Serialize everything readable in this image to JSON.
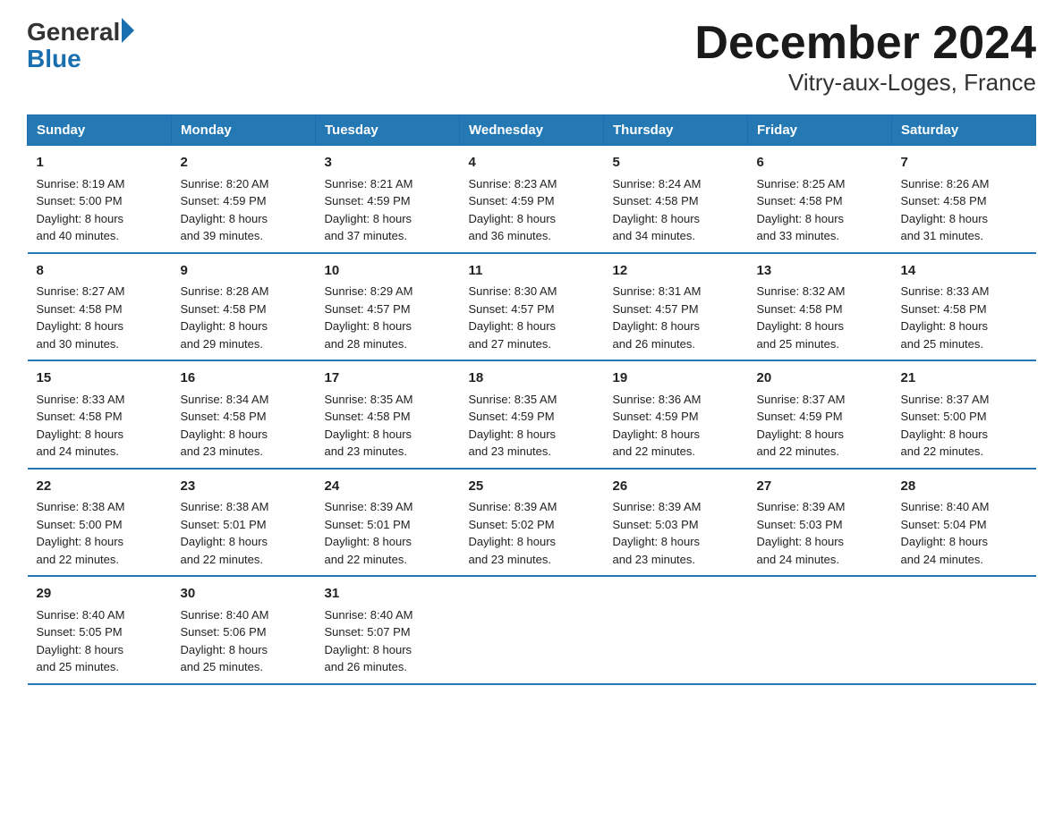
{
  "logo": {
    "general": "General",
    "blue": "Blue"
  },
  "title": "December 2024",
  "subtitle": "Vitry-aux-Loges, France",
  "headers": [
    "Sunday",
    "Monday",
    "Tuesday",
    "Wednesday",
    "Thursday",
    "Friday",
    "Saturday"
  ],
  "weeks": [
    [
      {
        "day": "1",
        "sunrise": "8:19 AM",
        "sunset": "5:00 PM",
        "daylight": "8 hours and 40 minutes."
      },
      {
        "day": "2",
        "sunrise": "8:20 AM",
        "sunset": "4:59 PM",
        "daylight": "8 hours and 39 minutes."
      },
      {
        "day": "3",
        "sunrise": "8:21 AM",
        "sunset": "4:59 PM",
        "daylight": "8 hours and 37 minutes."
      },
      {
        "day": "4",
        "sunrise": "8:23 AM",
        "sunset": "4:59 PM",
        "daylight": "8 hours and 36 minutes."
      },
      {
        "day": "5",
        "sunrise": "8:24 AM",
        "sunset": "4:58 PM",
        "daylight": "8 hours and 34 minutes."
      },
      {
        "day": "6",
        "sunrise": "8:25 AM",
        "sunset": "4:58 PM",
        "daylight": "8 hours and 33 minutes."
      },
      {
        "day": "7",
        "sunrise": "8:26 AM",
        "sunset": "4:58 PM",
        "daylight": "8 hours and 31 minutes."
      }
    ],
    [
      {
        "day": "8",
        "sunrise": "8:27 AM",
        "sunset": "4:58 PM",
        "daylight": "8 hours and 30 minutes."
      },
      {
        "day": "9",
        "sunrise": "8:28 AM",
        "sunset": "4:58 PM",
        "daylight": "8 hours and 29 minutes."
      },
      {
        "day": "10",
        "sunrise": "8:29 AM",
        "sunset": "4:57 PM",
        "daylight": "8 hours and 28 minutes."
      },
      {
        "day": "11",
        "sunrise": "8:30 AM",
        "sunset": "4:57 PM",
        "daylight": "8 hours and 27 minutes."
      },
      {
        "day": "12",
        "sunrise": "8:31 AM",
        "sunset": "4:57 PM",
        "daylight": "8 hours and 26 minutes."
      },
      {
        "day": "13",
        "sunrise": "8:32 AM",
        "sunset": "4:58 PM",
        "daylight": "8 hours and 25 minutes."
      },
      {
        "day": "14",
        "sunrise": "8:33 AM",
        "sunset": "4:58 PM",
        "daylight": "8 hours and 25 minutes."
      }
    ],
    [
      {
        "day": "15",
        "sunrise": "8:33 AM",
        "sunset": "4:58 PM",
        "daylight": "8 hours and 24 minutes."
      },
      {
        "day": "16",
        "sunrise": "8:34 AM",
        "sunset": "4:58 PM",
        "daylight": "8 hours and 23 minutes."
      },
      {
        "day": "17",
        "sunrise": "8:35 AM",
        "sunset": "4:58 PM",
        "daylight": "8 hours and 23 minutes."
      },
      {
        "day": "18",
        "sunrise": "8:35 AM",
        "sunset": "4:59 PM",
        "daylight": "8 hours and 23 minutes."
      },
      {
        "day": "19",
        "sunrise": "8:36 AM",
        "sunset": "4:59 PM",
        "daylight": "8 hours and 22 minutes."
      },
      {
        "day": "20",
        "sunrise": "8:37 AM",
        "sunset": "4:59 PM",
        "daylight": "8 hours and 22 minutes."
      },
      {
        "day": "21",
        "sunrise": "8:37 AM",
        "sunset": "5:00 PM",
        "daylight": "8 hours and 22 minutes."
      }
    ],
    [
      {
        "day": "22",
        "sunrise": "8:38 AM",
        "sunset": "5:00 PM",
        "daylight": "8 hours and 22 minutes."
      },
      {
        "day": "23",
        "sunrise": "8:38 AM",
        "sunset": "5:01 PM",
        "daylight": "8 hours and 22 minutes."
      },
      {
        "day": "24",
        "sunrise": "8:39 AM",
        "sunset": "5:01 PM",
        "daylight": "8 hours and 22 minutes."
      },
      {
        "day": "25",
        "sunrise": "8:39 AM",
        "sunset": "5:02 PM",
        "daylight": "8 hours and 23 minutes."
      },
      {
        "day": "26",
        "sunrise": "8:39 AM",
        "sunset": "5:03 PM",
        "daylight": "8 hours and 23 minutes."
      },
      {
        "day": "27",
        "sunrise": "8:39 AM",
        "sunset": "5:03 PM",
        "daylight": "8 hours and 24 minutes."
      },
      {
        "day": "28",
        "sunrise": "8:40 AM",
        "sunset": "5:04 PM",
        "daylight": "8 hours and 24 minutes."
      }
    ],
    [
      {
        "day": "29",
        "sunrise": "8:40 AM",
        "sunset": "5:05 PM",
        "daylight": "8 hours and 25 minutes."
      },
      {
        "day": "30",
        "sunrise": "8:40 AM",
        "sunset": "5:06 PM",
        "daylight": "8 hours and 25 minutes."
      },
      {
        "day": "31",
        "sunrise": "8:40 AM",
        "sunset": "5:07 PM",
        "daylight": "8 hours and 26 minutes."
      },
      null,
      null,
      null,
      null
    ]
  ],
  "labels": {
    "sunrise": "Sunrise:",
    "sunset": "Sunset:",
    "daylight": "Daylight:"
  }
}
